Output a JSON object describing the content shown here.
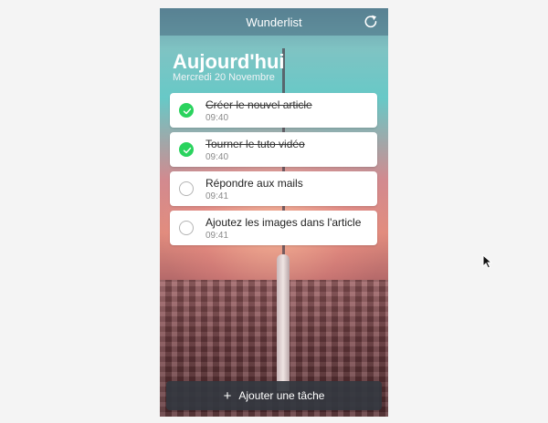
{
  "app": {
    "title": "Wunderlist"
  },
  "list": {
    "title": "Aujourd'hui",
    "date": "Mercredi 20 Novembre"
  },
  "tasks": [
    {
      "title": "Créer le nouvel article",
      "time": "09:40",
      "done": true
    },
    {
      "title": "Tourner le tuto vidéo",
      "time": "09:40",
      "done": true
    },
    {
      "title": "Répondre aux mails",
      "time": "09:41",
      "done": false
    },
    {
      "title": "Ajoutez les images dans l'article",
      "time": "09:41",
      "done": false
    }
  ],
  "add_task": {
    "label": "Ajouter une tâche",
    "icon": "plus-icon"
  },
  "icons": {
    "sync": "sync-icon",
    "check": "checkmark-icon",
    "cursor": "mouse-cursor-icon"
  },
  "colors": {
    "done": "#2ad35e",
    "add_bar": "#343840",
    "header": "#486e82"
  }
}
